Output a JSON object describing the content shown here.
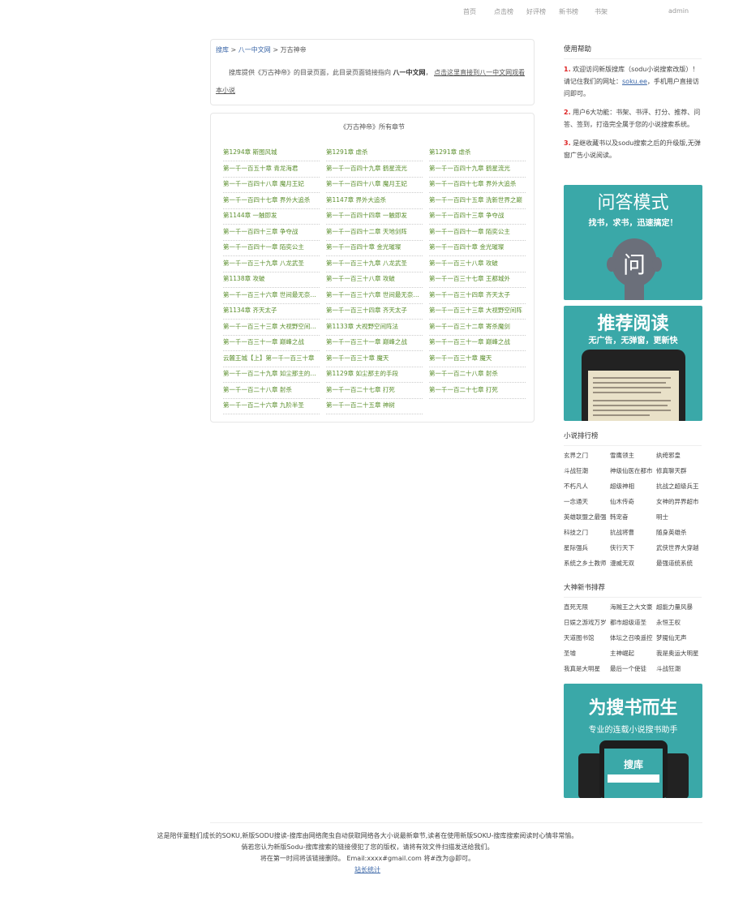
{
  "nav": {
    "items": [
      "首页",
      "点击榜",
      "好评榜",
      "新书榜",
      "书架"
    ],
    "user": "admin"
  },
  "breadcrumb": {
    "home": "搜库",
    "site": "八一中文网",
    "book": "万古神帝",
    "sep": ">"
  },
  "intro": {
    "prefix": "搜库提供《万古神帝》的目录页面，此目录页面链接指向",
    "site": "八一中文网",
    "comma": "，",
    "link": "点击这里直接到八一中文网观看本小说"
  },
  "chapters": {
    "title": "《万古神帝》所有章节",
    "items": [
      "第1294章 斯图风城",
      "第1291章 虐杀",
      "第1291章 虐杀",
      "第一千一百五十章 青龙海君",
      "第一千一百四十九章 鹤星流光",
      "第一千一百四十九章 鹤星流光",
      "第一千一百四十八章 魔月王妃",
      "第一千一百四十八章 魔月王妃",
      "第一千一百四十七章 界外大追杀",
      "第一千一百四十七章 界外大追杀",
      "第1147章 界外大追杀",
      "第一千一百四十五章 洗新世界之巅",
      "第1144章 一触即发",
      "第一千一百四十四章 一触即发",
      "第一千一百四十三章 争夺战",
      "第一千一百四十三章 争夺战",
      "第一千一百四十二章 天地剑阵",
      "第一千一百四十一章 陌奕公主",
      "第一千一百四十一章 陌奕公主",
      "第一千一百四十章 金光璀璨",
      "第一千一百四十章 金光璀璨",
      "第一千一百三十九章 八龙武圣",
      "第一千一百三十九章 八龙武圣",
      "第一千一百三十八章 攻破",
      "第1138章 攻破",
      "第一千一百三十八章 攻破",
      "第一千一百三十七章 王都城外",
      "第一千一百三十六章 世间最无奈的事",
      "第一千一百三十六章 世间最无奈的事",
      "第一千一百三十四章 齐天太子",
      "第1134章 齐天太子",
      "第一千一百三十四章 齐天太子",
      "第一千一百三十三章 大视野空间阵",
      "第一千一百三十三章 大视野空间阵法",
      "第1133章 大视野空间阵法",
      "第一千一百三十二章 寄杀魔剑",
      "第一千一百三十一章 巅峰之战",
      "第一千一百三十一章 巅峰之战",
      "第一千一百三十一章 巅峰之战",
      "云麓王城【上】第一千一百三十章",
      "第一千一百三十章 魔天",
      "第一千一百三十章 魔天",
      "第一千一百二十九章 如尘那主的手段",
      "第1129章 如尘那主的手段",
      "第一千一百二十八章 射杀",
      "第一千一百二十八章 射杀",
      "第一千一百二十七章 打死",
      "第一千一百二十七章 打死",
      "第一千一百二十六章 九阶半圣",
      "第一千一百二十五章 神树"
    ]
  },
  "sidebar": {
    "help_title": "使用帮助",
    "help": [
      {
        "num": "1.",
        "text": "欢迎访问新版搜库（sodu小说搜索改版）！请记住我们的网址：",
        "link": "soku.ee",
        "tail": "，手机用户直接访问即可。"
      },
      {
        "num": "2.",
        "text": "用户6大功能：书架、书评、打分、推荐、问答、签到，打造完全属于您的小说搜索系统。",
        "link": "",
        "tail": ""
      },
      {
        "num": "3.",
        "text": "是继收藏书以及sodu搜索之后的升级版,无弹窗广告小说阅读。",
        "link": "",
        "tail": ""
      }
    ],
    "banner1": {
      "big": "问答模式",
      "small": "找书，求书，迅速搞定！",
      "glyph": "问"
    },
    "banner2": {
      "big": "推荐阅读",
      "small": "无广告，无弹窗，更新快"
    },
    "rank_title": "小说排行榜",
    "rank": [
      "玄界之门",
      "雪鹰领主",
      "纨绔邪皇",
      "斗战狂潮",
      "神级仙医在都市",
      "修真聊天群",
      "不朽凡人",
      "超级神相",
      "抗战之超级兵王",
      "一念通天",
      "仙木传奇",
      "女神的异界超市",
      "英雄联盟之最强",
      "韩宠奋",
      "明士",
      "科技之门",
      "抗战将曹",
      "随身英雄杀",
      "星际强兵",
      "侠行天下",
      "武侠世界大穿越",
      "系统之乡土教师",
      "漫威无双",
      "最强道统系统"
    ],
    "new_title": "大神新书排荐",
    "new": [
      "直死无限",
      "海贼王之大文豪",
      "超能力量风暴",
      "日娱之游戏万岁",
      "都市超级道圣",
      "永恒王权",
      "天道图书馆",
      "体坛之召唤遥控",
      "梦魇仙无声",
      "圣墟",
      "主神崛起",
      "我是奥运大明星",
      "我真是大明星",
      "最后一个使徒",
      "斗战狂潮"
    ],
    "banner3": {
      "big": "为搜书而生",
      "small": "专业的连载小说搜书助手",
      "app": "搜库"
    }
  },
  "footer": {
    "line1": "这是陪伴童鞋们成长的SOKU,新版SODU搜读-搜库由网络爬虫自动获取网络各大小说最新章节,读者在使用新版SOKU-搜库搜索阅读时心情非常愉。",
    "line2": "倘若您认为新版Sodu-搜库搜索的链接侵犯了您的版权，请将有效文件扫描发送给我们。",
    "line3": "将在第一时间将该链接删除。 Email:xxxx#gmail.com 将#改为@即可。",
    "stats": "站长统计"
  },
  "colors": {
    "chapter_link": "#5b8f2d",
    "accent_red": "#d22",
    "banner_teal": "#3aa8a8",
    "link_blue": "#3a66a7"
  }
}
